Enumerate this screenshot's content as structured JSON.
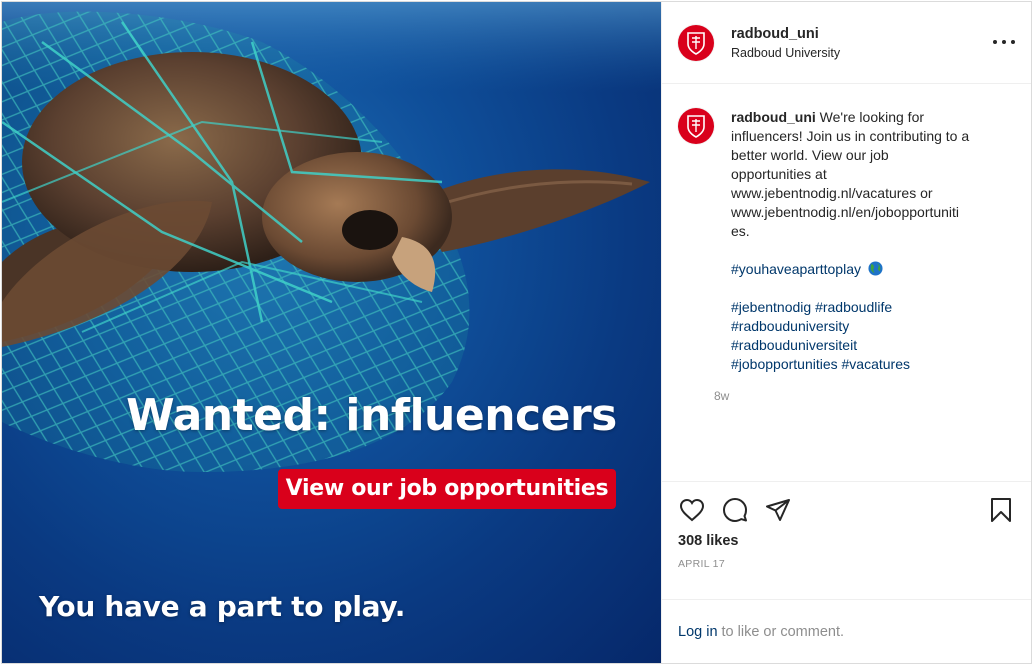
{
  "post": {
    "image": {
      "headline": "Wanted: influencers",
      "cta": "View our job opportunities",
      "tagline": "You have a part to play."
    },
    "header": {
      "username": "radboud_uni",
      "subname": "Radboud University"
    },
    "caption": {
      "username": "radboud_uni",
      "lines": [
        "We're looking for",
        "influencers! Join us in contributing to a",
        "better world. View our job",
        "opportunities at",
        "www.jebentnodig.nl/vacatures or",
        "www.jebentnodig.nl/en/jobopportuniti",
        "es."
      ],
      "hashtag_main": "#youhaveaparttoplay",
      "hashtag_lines": [
        "#jebentnodig #radboudlife",
        "#radbouduniversity",
        "#radbouduniversiteit",
        "#jobopportunities #vacatures"
      ],
      "time_ago": "8w"
    },
    "likes": "308 likes",
    "date": "APRIL 17",
    "login": {
      "link": "Log in",
      "rest": "to like or comment."
    },
    "icons": {
      "avatar": "radboud-logo-icon",
      "more": "more-options-icon",
      "like": "heart-icon",
      "comment": "comment-icon",
      "share": "share-icon",
      "save": "bookmark-icon",
      "emoji": "globe-emoji-icon"
    },
    "colors": {
      "brand_red": "#d9001b",
      "link_blue": "#00376b",
      "muted": "#8e8e8e"
    }
  }
}
